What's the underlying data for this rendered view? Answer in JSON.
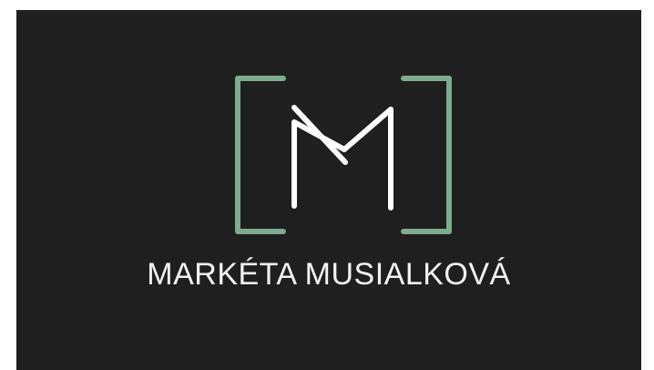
{
  "card": {
    "name": "MARKÉTA MUSIALKOVÁ",
    "logo_letter": "M",
    "background_color": "#1f1f1f",
    "bracket_color": "#7fac8c",
    "monogram_color": "#ffffff",
    "text_color": "#f2f2f2"
  }
}
